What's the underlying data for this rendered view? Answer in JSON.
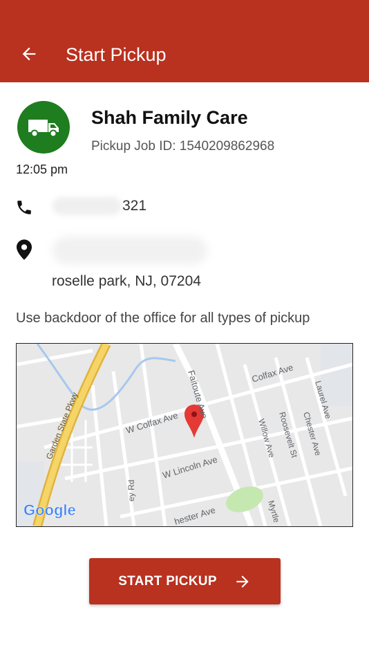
{
  "header": {
    "title": "Start Pickup",
    "back_icon": "arrow-back-icon"
  },
  "job": {
    "customer_name": "Shah Family Care",
    "pickup_job_id": "Pickup Job ID: 1540209862968",
    "time": "12:05 pm",
    "avatar_icon": "truck-icon"
  },
  "contact": {
    "phone_visible_suffix": "321",
    "phone_icon": "phone-icon"
  },
  "address": {
    "city_line": "roselle park, NJ, 07204",
    "location_icon": "location-pin-icon"
  },
  "note": "Use backdoor of the office for all types of pickup",
  "map": {
    "labels": {
      "colfax_ave": "Colfax Ave",
      "w_colfax_ave": "W Colfax Ave",
      "w_lincoln_ave": "W Lincoln Ave",
      "faitoute_ave": "Faitoute Ave",
      "garden_state_pkwy": "Garden State Pkwy",
      "willow_ave": "Willow Ave",
      "roosevelt_st": "Roosevelt St",
      "chester_ave_right": "Chester Ave",
      "laurel_ave": "Laurel Ave",
      "ey_rd": "ey Rd",
      "hester_ave": "hester Ave",
      "myrtle": "Myrtle",
      "google": "Google"
    },
    "colors": {
      "highway": "#f0c64f",
      "water": "#a6c8ef",
      "park": "#c5e8b0",
      "pin": "#e53935"
    }
  },
  "actions": {
    "start_label": "START PICKUP",
    "start_icon": "arrow-forward-icon"
  },
  "colors": {
    "primary": "#b9311f",
    "avatar": "#1e7d1e"
  }
}
